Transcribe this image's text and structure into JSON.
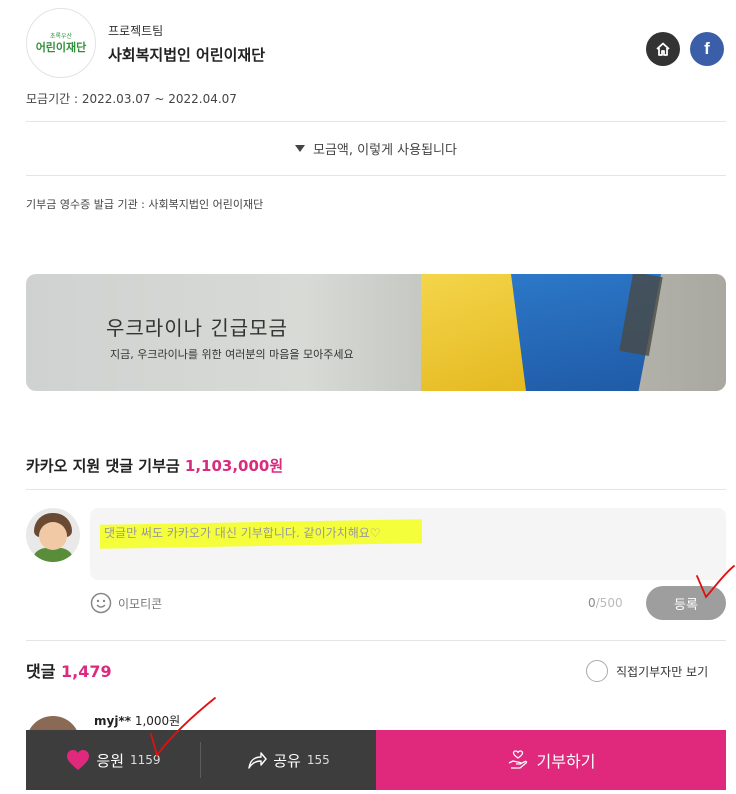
{
  "header": {
    "logo": {
      "small": "초록우산",
      "main": "어린이재단"
    },
    "org_sub": "프로젝트팀",
    "org_name": "사회복지법인 어린이재단",
    "home_icon": "home-icon",
    "facebook_label": "f"
  },
  "campaign": {
    "period": "모금기간 : 2022.03.07 ~ 2022.04.07",
    "usage_toggle": "모금액, 이렇게 사용됩니다",
    "receipt": "기부금 영수증 발급 기관 : 사회복지법인 어린이재단"
  },
  "banner": {
    "title": "우크라이나 긴급모금",
    "subtitle": "지금, 우크라이나를 위한 여러분의 마음을 모아주세요"
  },
  "support": {
    "label": "카카오 지원 댓글 기부금",
    "amount": "1,103,000원"
  },
  "comment_form": {
    "placeholder": "댓글만 써도 카카오가 대신 기부합니다. 같이가치해요♡",
    "emoticon_label": "이모티콘",
    "count": "0",
    "max": "/500",
    "register_label": "등록"
  },
  "comments": {
    "label": "댓글",
    "count": "1,479",
    "donor_only_label": "직접기부자만 보기",
    "first": {
      "user": "myj**",
      "amount": "1,000원"
    }
  },
  "bottom_bar": {
    "cheer_label": "응원",
    "cheer_count": "1159",
    "share_label": "공유",
    "share_count": "155",
    "donate_label": "기부하기"
  },
  "colors": {
    "accent": "#e0297d",
    "highlight": "#f5ff1a",
    "annotation": "#e01010",
    "facebook": "#3b5ea8"
  }
}
